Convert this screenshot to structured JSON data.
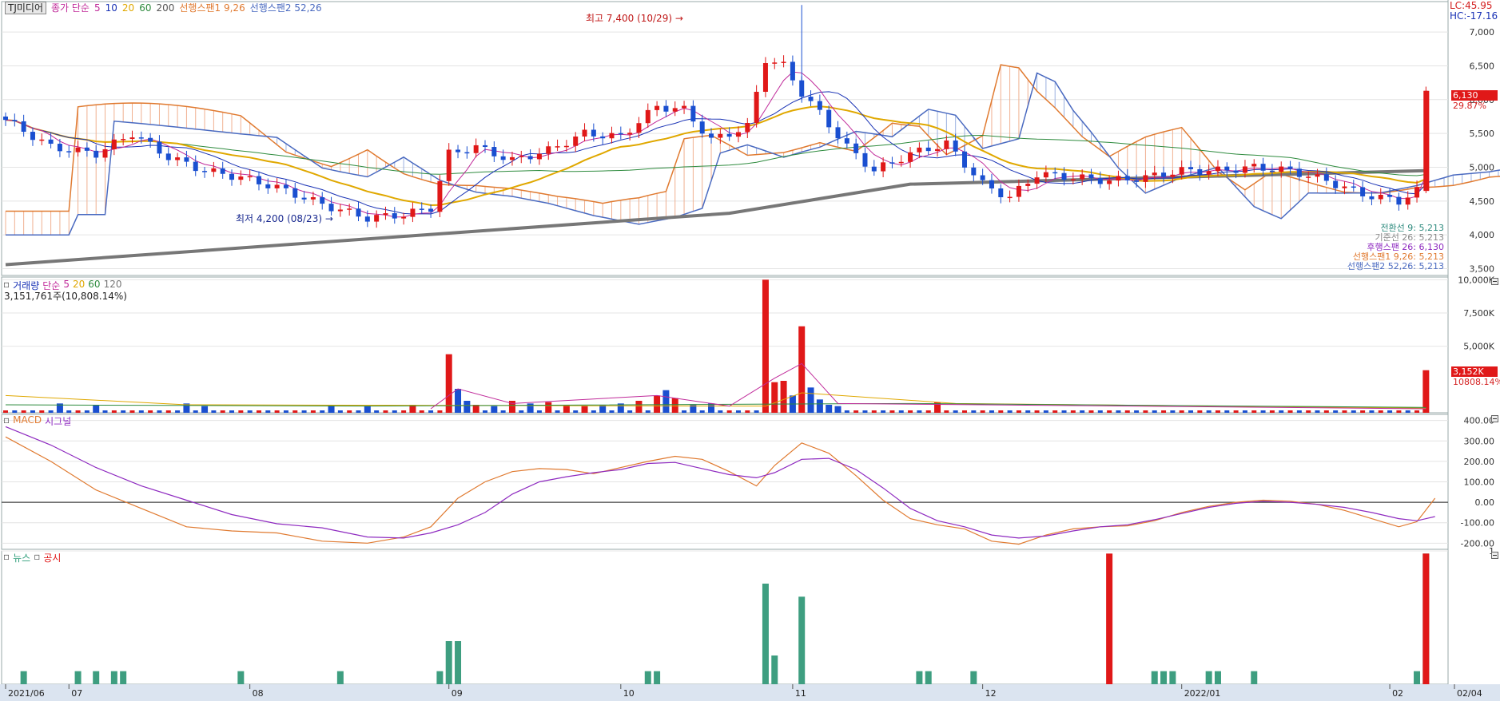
{
  "price_legend": {
    "stock_name": "TJ미디어",
    "ma_label": "종가 단순",
    "ma_periods": [
      {
        "label": "5",
        "color": "#c02a9a"
      },
      {
        "label": "10",
        "color": "#1a33b5"
      },
      {
        "label": "20",
        "color": "#e0a800"
      },
      {
        "label": "60",
        "color": "#2e8b3e"
      },
      {
        "label": "200",
        "color": "#555555"
      }
    ],
    "span1_label": "선행스팬1 9,26",
    "span2_label": "선행스팬2 52,26",
    "lc_label": "LC:45.95",
    "hc_label": "HC:-17.16",
    "high_annotation": "최고 7,400 (10/29)",
    "low_annotation": "최저 4,200 (08/23)",
    "last_price_badge": "6,130",
    "last_change_badge": "29.87%"
  },
  "ichimoku_readout": [
    {
      "text": "전환선 9: 5,213",
      "color": "#2e8b7e"
    },
    {
      "text": "기준선 26: 5,213",
      "color": "#888888"
    },
    {
      "text": "후행스팬 26: 6,130",
      "color": "#8e2ac0"
    },
    {
      "text": "선행스팬1 9,26: 5,213",
      "color": "#e07a30"
    },
    {
      "text": "선행스팬2 52,26: 5,213",
      "color": "#4a6ac0"
    }
  ],
  "volume_legend": {
    "title": "거래량",
    "ma_label": "단순",
    "periods": [
      "5",
      "20",
      "60",
      "120"
    ],
    "current": "3,151,761주(10,808.14%)",
    "badge": "3,152K",
    "badge2": "10808.14%"
  },
  "macd_legend": {
    "title": "MACD",
    "signal": "시그널"
  },
  "news_legend": {
    "news": "뉴스",
    "disclosure": "공시"
  },
  "chart_data": {
    "type": "candlestick",
    "x": [
      "2021/06",
      "07",
      "08",
      "09",
      "10",
      "11",
      "12",
      "2022/01",
      "02",
      "02/04"
    ],
    "price": {
      "ylim": [
        3400,
        7450
      ],
      "ticks": [
        "3,500",
        "4,000",
        "4,500",
        "5,000",
        "5,500",
        "6,000",
        "6,500",
        "7,000"
      ],
      "high": 7400,
      "low": 4200,
      "last": 6130
    },
    "volume": {
      "ylim": [
        0,
        10200
      ],
      "unit": "K",
      "ticks": [
        "5,000K",
        "7,500K",
        "10,000K"
      ],
      "bars": [
        {
          "i": 6,
          "v": 700
        },
        {
          "i": 10,
          "v": 600
        },
        {
          "i": 20,
          "v": 700
        },
        {
          "i": 22,
          "v": 500
        },
        {
          "i": 36,
          "v": 600
        },
        {
          "i": 40,
          "v": 500
        },
        {
          "i": 45,
          "v": 600
        },
        {
          "i": 49,
          "v": 4400
        },
        {
          "i": 50,
          "v": 1800
        },
        {
          "i": 51,
          "v": 900
        },
        {
          "i": 52,
          "v": 600
        },
        {
          "i": 54,
          "v": 500
        },
        {
          "i": 56,
          "v": 900
        },
        {
          "i": 58,
          "v": 700
        },
        {
          "i": 60,
          "v": 800
        },
        {
          "i": 62,
          "v": 600
        },
        {
          "i": 64,
          "v": 500
        },
        {
          "i": 66,
          "v": 600
        },
        {
          "i": 68,
          "v": 700
        },
        {
          "i": 70,
          "v": 900
        },
        {
          "i": 72,
          "v": 1300
        },
        {
          "i": 73,
          "v": 1700
        },
        {
          "i": 74,
          "v": 1100
        },
        {
          "i": 76,
          "v": 600
        },
        {
          "i": 78,
          "v": 700
        },
        {
          "i": 84,
          "v": 10000
        },
        {
          "i": 85,
          "v": 2300
        },
        {
          "i": 86,
          "v": 2400
        },
        {
          "i": 87,
          "v": 1300
        },
        {
          "i": 88,
          "v": 6500
        },
        {
          "i": 89,
          "v": 1900
        },
        {
          "i": 90,
          "v": 1000
        },
        {
          "i": 91,
          "v": 600
        },
        {
          "i": 92,
          "v": 500
        },
        {
          "i": 103,
          "v": 800
        },
        {
          "i": 157,
          "v": 3200
        }
      ]
    },
    "macd": {
      "ylim": [
        -230,
        430
      ],
      "ticks": [
        "400.00",
        "300.00",
        "200.00",
        "100.00",
        "0.00",
        "-100.00",
        "-200.00"
      ],
      "macd": [
        [
          0,
          320
        ],
        [
          5,
          200
        ],
        [
          10,
          60
        ],
        [
          15,
          -30
        ],
        [
          20,
          -120
        ],
        [
          25,
          -140
        ],
        [
          30,
          -150
        ],
        [
          35,
          -190
        ],
        [
          40,
          -200
        ],
        [
          44,
          -170
        ],
        [
          47,
          -120
        ],
        [
          50,
          20
        ],
        [
          53,
          100
        ],
        [
          56,
          150
        ],
        [
          59,
          165
        ],
        [
          62,
          160
        ],
        [
          65,
          140
        ],
        [
          68,
          170
        ],
        [
          71,
          200
        ],
        [
          74,
          225
        ],
        [
          77,
          210
        ],
        [
          80,
          150
        ],
        [
          83,
          80
        ],
        [
          85,
          180
        ],
        [
          88,
          290
        ],
        [
          91,
          240
        ],
        [
          94,
          130
        ],
        [
          97,
          10
        ],
        [
          100,
          -80
        ],
        [
          103,
          -110
        ],
        [
          106,
          -130
        ],
        [
          109,
          -190
        ],
        [
          112,
          -205
        ],
        [
          115,
          -160
        ],
        [
          118,
          -130
        ],
        [
          121,
          -120
        ],
        [
          124,
          -115
        ],
        [
          127,
          -90
        ],
        [
          130,
          -50
        ],
        [
          133,
          -20
        ],
        [
          136,
          0
        ],
        [
          139,
          10
        ],
        [
          142,
          5
        ],
        [
          145,
          -10
        ],
        [
          148,
          -40
        ],
        [
          151,
          -80
        ],
        [
          154,
          -120
        ],
        [
          156,
          -95
        ],
        [
          158,
          20
        ]
      ],
      "signal": [
        [
          0,
          370
        ],
        [
          5,
          280
        ],
        [
          10,
          170
        ],
        [
          15,
          80
        ],
        [
          20,
          10
        ],
        [
          25,
          -60
        ],
        [
          30,
          -105
        ],
        [
          35,
          -125
        ],
        [
          40,
          -170
        ],
        [
          44,
          -175
        ],
        [
          47,
          -150
        ],
        [
          50,
          -110
        ],
        [
          53,
          -50
        ],
        [
          56,
          40
        ],
        [
          59,
          100
        ],
        [
          62,
          125
        ],
        [
          65,
          145
        ],
        [
          68,
          160
        ],
        [
          71,
          190
        ],
        [
          74,
          195
        ],
        [
          77,
          165
        ],
        [
          80,
          135
        ],
        [
          83,
          120
        ],
        [
          85,
          145
        ],
        [
          88,
          210
        ],
        [
          91,
          215
        ],
        [
          94,
          160
        ],
        [
          97,
          70
        ],
        [
          100,
          -30
        ],
        [
          103,
          -90
        ],
        [
          106,
          -120
        ],
        [
          109,
          -160
        ],
        [
          112,
          -175
        ],
        [
          115,
          -165
        ],
        [
          118,
          -140
        ],
        [
          121,
          -120
        ],
        [
          124,
          -110
        ],
        [
          127,
          -85
        ],
        [
          130,
          -55
        ],
        [
          133,
          -25
        ],
        [
          136,
          -5
        ],
        [
          139,
          5
        ],
        [
          142,
          0
        ],
        [
          145,
          -10
        ],
        [
          148,
          -25
        ],
        [
          151,
          -50
        ],
        [
          154,
          -80
        ],
        [
          156,
          -90
        ],
        [
          158,
          -70
        ]
      ]
    },
    "news": {
      "ylim": [
        0,
        1
      ],
      "ticks": [
        "1"
      ],
      "news_bars": [
        [
          2,
          0.1
        ],
        [
          8,
          0.1
        ],
        [
          10,
          0.1
        ],
        [
          12,
          0.1
        ],
        [
          13,
          0.1
        ],
        [
          26,
          0.1
        ],
        [
          37,
          0.1
        ],
        [
          48,
          0.1
        ],
        [
          49,
          0.33
        ],
        [
          50,
          0.33
        ],
        [
          71,
          0.1
        ],
        [
          72,
          0.1
        ],
        [
          84,
          0.77
        ],
        [
          85,
          0.22
        ],
        [
          88,
          0.67
        ],
        [
          101,
          0.1
        ],
        [
          102,
          0.1
        ],
        [
          107,
          0.1
        ],
        [
          127,
          0.1
        ],
        [
          128,
          0.1
        ],
        [
          129,
          0.1
        ],
        [
          133,
          0.1
        ],
        [
          134,
          0.1
        ],
        [
          138,
          0.1
        ],
        [
          156,
          0.1
        ],
        [
          157,
          1
        ]
      ],
      "disclosure_bars": [
        [
          122,
          1
        ],
        [
          157,
          1
        ]
      ]
    }
  }
}
